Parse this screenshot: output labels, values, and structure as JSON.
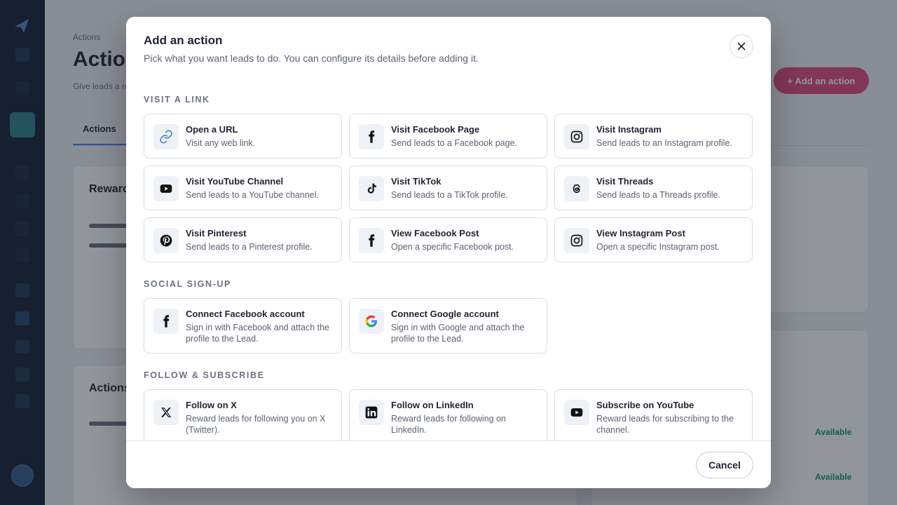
{
  "background": {
    "breadcrumb": "Actions",
    "page_title": "Actions",
    "page_subtitle": "Give leads a reason to act",
    "primary_button": "+ Add an action",
    "tab_label": "Actions",
    "card1_title": "Rewards",
    "card2_title": "Actions",
    "status_label": "Available"
  },
  "modal": {
    "title": "Add an action",
    "subtitle": "Pick what you want leads to do. You can configure its details before adding it.",
    "close_icon": "close-icon",
    "cancel_label": "Cancel",
    "sections": [
      {
        "label": "Visit a link",
        "items": [
          {
            "title": "Open a URL",
            "desc": "Visit any web link.",
            "icon": "link-icon"
          },
          {
            "title": "Visit Facebook Page",
            "desc": "Send leads to a Facebook page.",
            "icon": "facebook-icon"
          },
          {
            "title": "Visit Instagram",
            "desc": "Send leads to an Instagram profile.",
            "icon": "instagram-icon"
          },
          {
            "title": "Visit YouTube Channel",
            "desc": "Send leads to a YouTube channel.",
            "icon": "youtube-icon"
          },
          {
            "title": "Visit TikTok",
            "desc": "Send leads to a TikTok profile.",
            "icon": "tiktok-icon"
          },
          {
            "title": "Visit Threads",
            "desc": "Send leads to a Threads profile.",
            "icon": "threads-icon"
          },
          {
            "title": "Visit Pinterest",
            "desc": "Send leads to a Pinterest profile.",
            "icon": "pinterest-icon"
          },
          {
            "title": "View Facebook Post",
            "desc": "Open a specific Facebook post.",
            "icon": "facebook-icon"
          },
          {
            "title": "View Instagram Post",
            "desc": "Open a specific Instagram post.",
            "icon": "instagram-icon"
          }
        ]
      },
      {
        "label": "Social sign-up",
        "items": [
          {
            "title": "Connect Facebook account",
            "desc": "Sign in with Facebook and attach the profile to the Lead.",
            "icon": "facebook-icon"
          },
          {
            "title": "Connect Google account",
            "desc": "Sign in with Google and attach the profile to the Lead.",
            "icon": "google-icon"
          }
        ]
      },
      {
        "label": "Follow & Subscribe",
        "items": [
          {
            "title": "Follow on X",
            "desc": "Reward leads for following you on X (Twitter).",
            "icon": "x-icon"
          },
          {
            "title": "Follow on LinkedIn",
            "desc": "Reward leads for following on LinkedIn.",
            "icon": "linkedin-icon"
          },
          {
            "title": "Subscribe on YouTube",
            "desc": "Reward leads for subscribing to the channel.",
            "icon": "youtube-icon"
          }
        ]
      }
    ]
  },
  "colors": {
    "accent_pink": "#e04a7e",
    "sidebar": "#132034",
    "link_blue": "#4a86c7",
    "available_green": "#10966b"
  }
}
